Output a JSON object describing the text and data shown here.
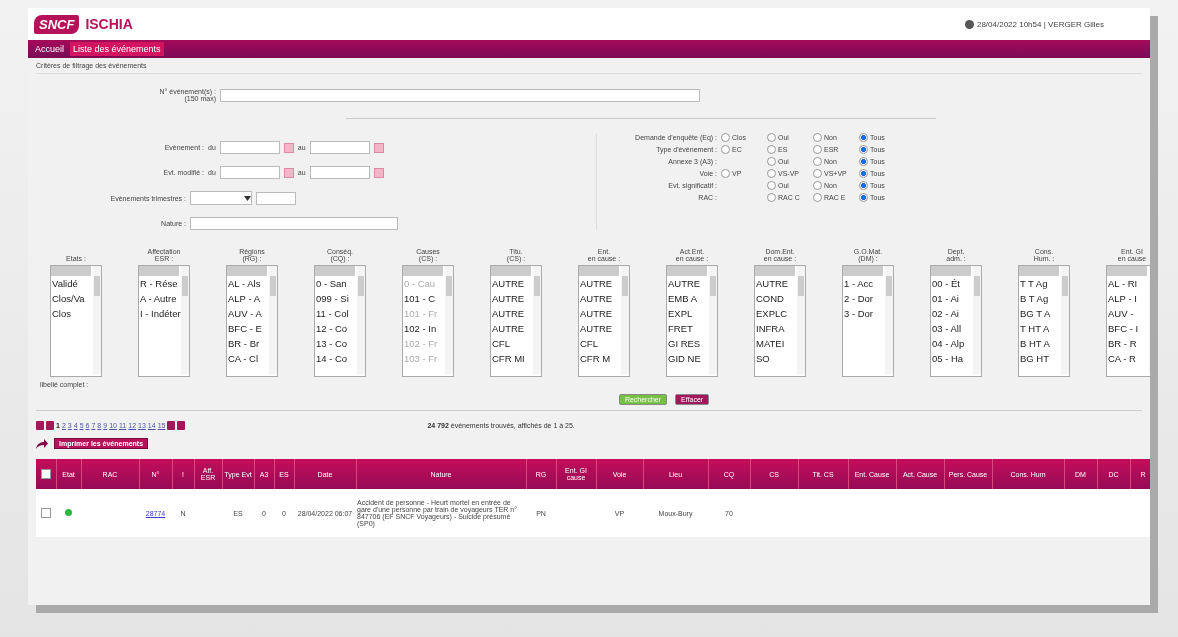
{
  "header": {
    "logo": "SNCF",
    "app_name": "ISCHIA",
    "user_info": "28/04/2022 10h54 | VERGER Gilles"
  },
  "crumbs": [
    {
      "label": "Accueil",
      "selected": false
    },
    {
      "label": "Liste des événements",
      "selected": true
    }
  ],
  "filters": {
    "legend": "Critères de filtrage des événements",
    "event_numbers": {
      "label": "N° événement(s) :",
      "hint": "(150 max)"
    },
    "date_rows": [
      {
        "label": "Evènement :",
        "from": "du",
        "to": "au"
      },
      {
        "label": "Evt. modifié :",
        "from": "du",
        "to": "au"
      }
    ],
    "quarter": {
      "label": "Evènements trimestres :"
    },
    "nature": {
      "label": "Nature :"
    },
    "radio_groups": [
      {
        "label": "Demande d'enquête (Eq) :",
        "options": [
          {
            "label": "Clos",
            "selected": false
          },
          {
            "label": "Oui",
            "selected": false
          },
          {
            "label": "Non",
            "selected": false
          },
          {
            "label": "Tous",
            "selected": true
          }
        ]
      },
      {
        "label": "Type d'événement :",
        "options": [
          {
            "label": "EC",
            "selected": false
          },
          {
            "label": "ES",
            "selected": false
          },
          {
            "label": "ESR",
            "selected": false
          },
          {
            "label": "Tous",
            "selected": true
          }
        ]
      },
      {
        "label": "Annexe 3 (A3) :",
        "options": [
          {
            "label": "Oui",
            "selected": false
          },
          {
            "label": "Non",
            "selected": false
          },
          {
            "label": "Tous",
            "selected": true
          }
        ]
      },
      {
        "label": "Voie :",
        "options": [
          {
            "label": "VP",
            "selected": false
          },
          {
            "label": "VS-VP",
            "selected": false
          },
          {
            "label": "VS+VP",
            "selected": false
          },
          {
            "label": "Tous",
            "selected": true
          }
        ]
      },
      {
        "label": "Evt. significatif :",
        "options": [
          {
            "label": "Oui",
            "selected": false
          },
          {
            "label": "Non",
            "selected": false
          },
          {
            "label": "Tous",
            "selected": true
          }
        ]
      },
      {
        "label": "RAC :",
        "options": [
          {
            "label": "RAC C",
            "selected": false
          },
          {
            "label": "RAC E",
            "selected": false
          },
          {
            "label": "Tous",
            "selected": true
          }
        ]
      }
    ],
    "listboxes": [
      {
        "label": [
          "Etats :"
        ],
        "items": [
          {
            "text": "Validé",
            "disabled": false
          },
          {
            "text": "Clos/Va",
            "disabled": false
          },
          {
            "text": "Clos",
            "disabled": false
          }
        ]
      },
      {
        "label": [
          "Affectation",
          "ESR :"
        ],
        "items": [
          {
            "text": "R - Rése",
            "disabled": false
          },
          {
            "text": "A - Autre",
            "disabled": false
          },
          {
            "text": "I - Indéter",
            "disabled": false
          }
        ]
      },
      {
        "label": [
          "Régions",
          "(RG) :"
        ],
        "items": [
          {
            "text": "AL - Als",
            "disabled": false
          },
          {
            "text": "ALP - A",
            "disabled": false
          },
          {
            "text": "AUV - A",
            "disabled": false
          },
          {
            "text": "BFC - E",
            "disabled": false
          },
          {
            "text": "BR - Br",
            "disabled": false
          },
          {
            "text": "CA - Cl",
            "disabled": false
          }
        ]
      },
      {
        "label": [
          "Conséq.",
          "(CQ) :"
        ],
        "items": [
          {
            "text": "0 - San",
            "disabled": false
          },
          {
            "text": "099 - Si",
            "disabled": false
          },
          {
            "text": "11 - Col",
            "disabled": false
          },
          {
            "text": "12 - Co",
            "disabled": false
          },
          {
            "text": "13 - Co",
            "disabled": false
          },
          {
            "text": "14 - Co",
            "disabled": false
          }
        ]
      },
      {
        "label": [
          "Causes",
          "(CS) :"
        ],
        "items": [
          {
            "text": "0 - Cau",
            "disabled": true
          },
          {
            "text": "101 - C",
            "disabled": false
          },
          {
            "text": "101 - Fr",
            "disabled": true
          },
          {
            "text": "102 - In",
            "disabled": false
          },
          {
            "text": "102 - Fr",
            "disabled": true
          },
          {
            "text": "103 - Fr",
            "disabled": true
          }
        ]
      },
      {
        "label": [
          "Titu.",
          "(CS) :"
        ],
        "items": [
          {
            "text": "AUTRE",
            "disabled": false
          },
          {
            "text": "AUTRE",
            "disabled": false
          },
          {
            "text": "AUTRE",
            "disabled": false
          },
          {
            "text": "AUTRE",
            "disabled": false
          },
          {
            "text": "CFL",
            "disabled": false
          },
          {
            "text": "CFR MI",
            "disabled": false
          }
        ]
      },
      {
        "label": [
          "Ent.",
          "en cause :"
        ],
        "items": [
          {
            "text": "AUTRE",
            "disabled": false
          },
          {
            "text": "AUTRE",
            "disabled": false
          },
          {
            "text": "AUTRE",
            "disabled": false
          },
          {
            "text": "AUTRE",
            "disabled": false
          },
          {
            "text": "CFL",
            "disabled": false
          },
          {
            "text": "CFR M",
            "disabled": false
          }
        ]
      },
      {
        "label": [
          "Act.Ent.",
          "en cause :"
        ],
        "items": [
          {
            "text": "AUTRE",
            "disabled": false
          },
          {
            "text": "EMB A",
            "disabled": false
          },
          {
            "text": "EXPL",
            "disabled": false
          },
          {
            "text": "FRET",
            "disabled": false
          },
          {
            "text": "GI RES",
            "disabled": false
          },
          {
            "text": "GID NE",
            "disabled": false
          }
        ]
      },
      {
        "label": [
          "Dom.Ent.",
          "en cause :"
        ],
        "items": [
          {
            "text": "AUTRE",
            "disabled": false
          },
          {
            "text": "COND",
            "disabled": false
          },
          {
            "text": "EXPLC",
            "disabled": false
          },
          {
            "text": "INFRA",
            "disabled": false
          },
          {
            "text": "MATEI",
            "disabled": false
          },
          {
            "text": "SO",
            "disabled": false
          }
        ]
      },
      {
        "label": [
          "G.O.Mat.",
          "(DM) :"
        ],
        "items": [
          {
            "text": "1 - Acc",
            "disabled": false
          },
          {
            "text": "2 - Dor",
            "disabled": false
          },
          {
            "text": "3 - Dor",
            "disabled": false
          }
        ]
      },
      {
        "label": [
          "Dept.",
          "adm. :"
        ],
        "items": [
          {
            "text": "00 - Ét",
            "disabled": false
          },
          {
            "text": "01 - Ai",
            "disabled": false
          },
          {
            "text": "02 - Ai",
            "disabled": false
          },
          {
            "text": "03 - All",
            "disabled": false
          },
          {
            "text": "04 - Alp",
            "disabled": false
          },
          {
            "text": "05 - Ha",
            "disabled": false
          }
        ]
      },
      {
        "label": [
          "Cons.",
          "Hum. :"
        ],
        "items": [
          {
            "text": "T T Ag",
            "disabled": false
          },
          {
            "text": "B T Ag",
            "disabled": false
          },
          {
            "text": "BG T A",
            "disabled": false
          },
          {
            "text": "T HT A",
            "disabled": false
          },
          {
            "text": "B HT A",
            "disabled": false
          },
          {
            "text": "BG HT",
            "disabled": false
          }
        ]
      },
      {
        "label": [
          "Ent. GI",
          "en cause"
        ],
        "items": [
          {
            "text": "AL - RI",
            "disabled": false
          },
          {
            "text": "ALP - I",
            "disabled": false
          },
          {
            "text": "AUV -",
            "disabled": false
          },
          {
            "text": "BFC - I",
            "disabled": false
          },
          {
            "text": "BR - R",
            "disabled": false
          },
          {
            "text": "CA - R",
            "disabled": false
          }
        ]
      }
    ],
    "full_label": "libellé complet :",
    "buttons": [
      {
        "label": "Rechercher",
        "kind": "primary"
      },
      {
        "label": "Effacer",
        "kind": "secondary"
      }
    ]
  },
  "pagination": {
    "pages": [
      {
        "label": "1",
        "selected": true
      },
      {
        "label": "2",
        "selected": false
      },
      {
        "label": "3",
        "selected": false
      },
      {
        "label": "4",
        "selected": false
      },
      {
        "label": "5",
        "selected": false
      },
      {
        "label": "6",
        "selected": false
      },
      {
        "label": "7",
        "selected": false
      },
      {
        "label": "8",
        "selected": false
      },
      {
        "label": "9",
        "selected": false
      },
      {
        "label": "10",
        "selected": false
      },
      {
        "label": "11",
        "selected": false
      },
      {
        "label": "12",
        "selected": false
      },
      {
        "label": "13",
        "selected": false
      },
      {
        "label": "14",
        "selected": false
      },
      {
        "label": "15",
        "selected": false
      }
    ],
    "summary": "**24 792** événements trouvés, affichés de 1 à 25."
  },
  "print_button": "Imprimer les événements",
  "table": {
    "header_checked": false,
    "columns": [
      "Etat",
      "RAC",
      "N°",
      "!",
      "Aff. ESR",
      "Type Evt",
      "A3",
      "ES",
      "Date",
      "Nature",
      "RG",
      "Ent. GI cause",
      "Voie",
      "Lieu",
      "CQ",
      "CS",
      "Tit. CS",
      "Ent. Cause",
      "Act. Cause",
      "Pers. Cause",
      "Cons. Hum",
      "DM",
      "DC",
      "R"
    ],
    "rows": [
      {
        "checked": false,
        "color": "#2db83d",
        "cells": [
          "",
          "",
          "28774",
          "N",
          "",
          "ES",
          "0",
          "0",
          "28/04/2022 06:07",
          "Accident de personne - Heurt mortel en entrée de gare d'une personne par train de voyageurs TER n° 847706 (EF SNCF Voyageurs) - Suicide présumé (SP0)",
          "PN",
          "",
          "VP",
          "Moux-Bury",
          "70",
          "",
          "",
          "",
          "",
          "",
          "",
          "",
          "",
          ""
        ]
      }
    ]
  }
}
